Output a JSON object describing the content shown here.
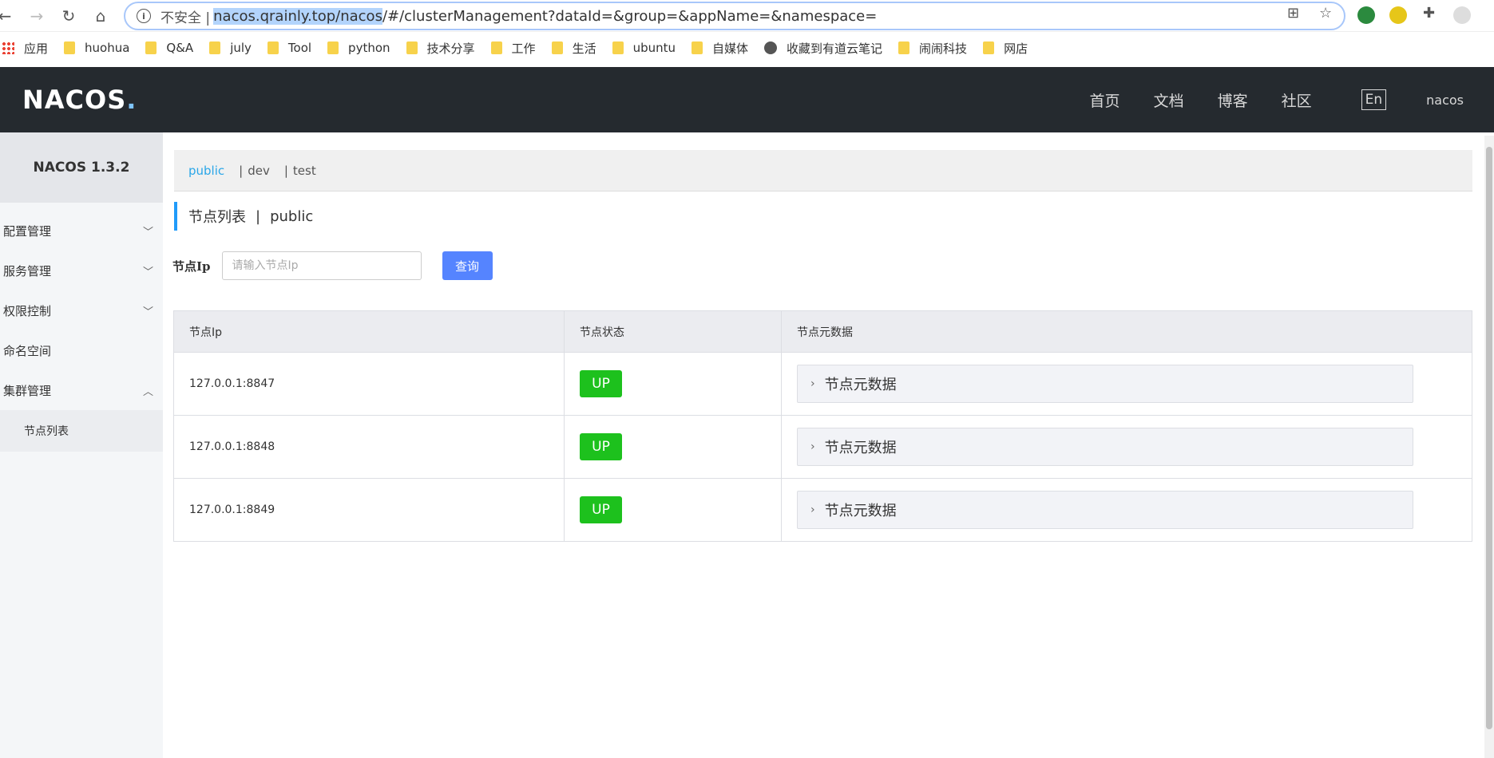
{
  "browser": {
    "address": {
      "insecure_label": "不安全 |",
      "url_highlight": "nacos.qrainly.top/nacos",
      "url_rest": "/#/clusterManagement?dataId=&group=&appName=&namespace="
    },
    "bookmarks": [
      {
        "label": "应用",
        "icon": "apps-icon"
      },
      {
        "label": "huohua",
        "icon": "folder-icon"
      },
      {
        "label": "Q&A",
        "icon": "folder-icon"
      },
      {
        "label": "july",
        "icon": "folder-icon"
      },
      {
        "label": "Tool",
        "icon": "folder-icon"
      },
      {
        "label": "python",
        "icon": "folder-icon"
      },
      {
        "label": "技术分享",
        "icon": "folder-icon"
      },
      {
        "label": "工作",
        "icon": "folder-icon"
      },
      {
        "label": "生活",
        "icon": "folder-icon"
      },
      {
        "label": "ubuntu",
        "icon": "folder-icon"
      },
      {
        "label": "自媒体",
        "icon": "folder-icon"
      },
      {
        "label": "收藏到有道云笔记",
        "icon": "globe-icon"
      },
      {
        "label": "闹闹科技",
        "icon": "folder-icon"
      },
      {
        "label": "网店",
        "icon": "folder-icon"
      }
    ]
  },
  "header": {
    "logo": "NACOS",
    "logo_dot": ".",
    "nav": [
      "首页",
      "文档",
      "博客",
      "社区"
    ],
    "lang": "En",
    "user": "nacos"
  },
  "sidebar": {
    "version": "NACOS 1.3.2",
    "items": [
      {
        "label": "配置管理",
        "chevron": "chevron-down-icon"
      },
      {
        "label": "服务管理",
        "chevron": "chevron-down-icon"
      },
      {
        "label": "权限控制",
        "chevron": "chevron-down-icon"
      },
      {
        "label": "命名空间",
        "chevron": ""
      },
      {
        "label": "集群管理",
        "chevron": "chevron-up-icon"
      }
    ],
    "sub_item": "节点列表"
  },
  "main": {
    "namespaces": [
      "public",
      "dev",
      "test"
    ],
    "namespace_sep": "|",
    "title": "节点列表",
    "title_divider": "|",
    "title_namespace": "public",
    "search": {
      "label": "节点Ip",
      "placeholder": "请输入节点Ip",
      "button": "查询"
    },
    "table": {
      "columns": [
        "节点Ip",
        "节点状态",
        "节点元数据"
      ],
      "rows": [
        {
          "ip": "127.0.0.1:8847",
          "status": "UP",
          "meta": "节点元数据"
        },
        {
          "ip": "127.0.0.1:8848",
          "status": "UP",
          "meta": "节点元数据"
        },
        {
          "ip": "127.0.0.1:8849",
          "status": "UP",
          "meta": "节点元数据"
        }
      ]
    }
  },
  "colors": {
    "header_bg": "#252a2f",
    "accent": "#209bfa",
    "button": "#5584ff",
    "status_up": "#1dc11d"
  }
}
